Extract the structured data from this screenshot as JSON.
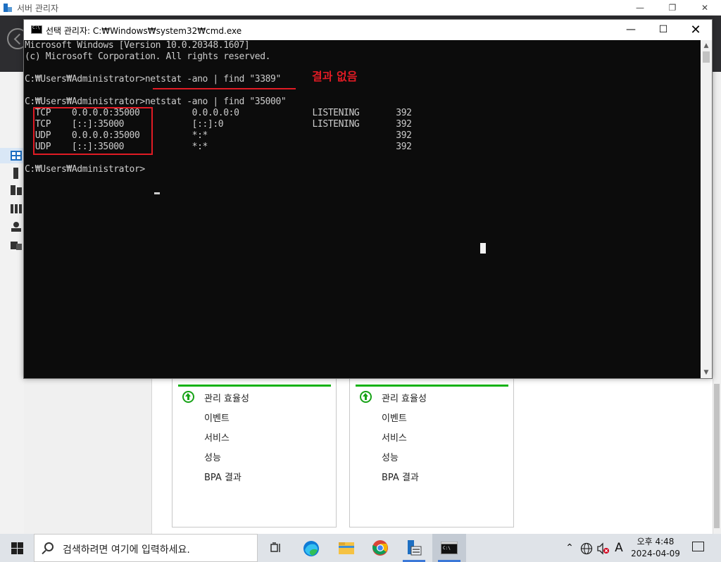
{
  "server_manager": {
    "title": "서버 관리자",
    "window_controls": {
      "minimize": "—",
      "restore": "❐",
      "close": "✕"
    },
    "tiles": [
      {
        "items": [
          "관리 효율성",
          "이벤트",
          "서비스",
          "성능",
          "BPA 결과"
        ]
      },
      {
        "items": [
          "관리 효율성",
          "이벤트",
          "서비스",
          "성능",
          "BPA 결과"
        ]
      }
    ]
  },
  "cmd": {
    "title": "선택 관리자: C:₩Windows₩system32₩cmd.exe",
    "window_controls": {
      "minimize": "—",
      "maximize": "☐",
      "close": "✕"
    },
    "lines": [
      "Microsoft Windows [Version 10.0.20348.1607]",
      "(c) Microsoft Corporation. All rights reserved.",
      "",
      "C:₩Users₩Administrator>netstat -ano | find \"3389\"",
      "",
      "C:₩Users₩Administrator>netstat -ano | find \"35000\"",
      "  TCP    0.0.0.0:35000          0.0.0.0:0              LISTENING       392",
      "  TCP    [::]:35000             [::]:0                 LISTENING       392",
      "  UDP    0.0.0.0:35000          *:*                                    392",
      "  UDP    [::]:35000             *:*                                    392",
      "",
      "C:₩Users₩Administrator>"
    ],
    "annotation_text": "결과 없음",
    "scroll_up": "▲",
    "scroll_down": "▼"
  },
  "taskbar": {
    "search_placeholder": "검색하려면 여기에 입력하세요.",
    "tray": {
      "chevron": "⌃",
      "ime": "A"
    },
    "clock": {
      "time": "오후 4:48",
      "date": "2024-04-09"
    }
  },
  "colors": {
    "annotation": "#e01b24",
    "tile_bar": "#17b317",
    "cmd_bg": "#0c0c0c",
    "taskbar_bg": "#dfe3e8"
  }
}
